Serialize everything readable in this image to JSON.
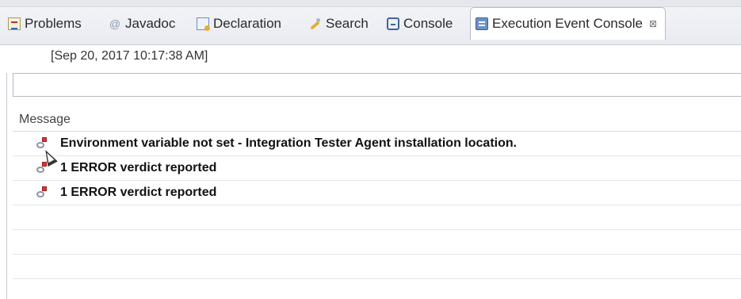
{
  "tabs": [
    {
      "label": "Problems",
      "icon": "problems-icon"
    },
    {
      "label": "Javadoc",
      "icon": "javadoc-icon"
    },
    {
      "label": "Declaration",
      "icon": "declaration-icon"
    },
    {
      "label": "Search",
      "icon": "search-icon"
    },
    {
      "label": "Console",
      "icon": "console-icon"
    },
    {
      "label": "Execution Event Console",
      "icon": "event-console-icon",
      "active": true,
      "close": "⊠"
    }
  ],
  "console": {
    "timestamp": "[Sep 20, 2017 10:17:38 AM]",
    "filter_value": ""
  },
  "table": {
    "column": "Message",
    "rows": [
      {
        "message": "Environment variable not set - Integration Tester Agent installation location.",
        "icon": "error-event-icon"
      },
      {
        "message": "1 ERROR verdict reported",
        "icon": "error-event-icon"
      },
      {
        "message": "1 ERROR verdict reported",
        "icon": "error-event-icon"
      }
    ]
  }
}
